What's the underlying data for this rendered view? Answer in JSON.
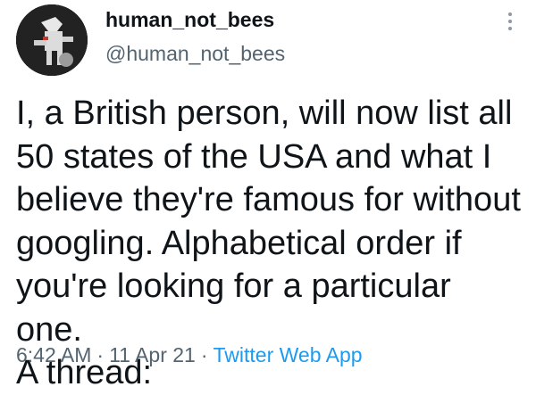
{
  "user": {
    "display_name": "human_not_bees",
    "handle": "@human_not_bees",
    "avatar_icon": "profile-avatar"
  },
  "header": {
    "more_icon": "more-vertical-icon"
  },
  "tweet": {
    "lines": [
      "I, a British person, will now list all",
      "50 states of the USA and what I",
      "believe they're famous for without",
      "googling. Alphabetical order if",
      "you're looking for a particular one.",
      "A thread:"
    ]
  },
  "meta": {
    "time": "6:42 AM",
    "separator": "·",
    "date": "11 Apr 21",
    "source": "Twitter Web App"
  },
  "colors": {
    "text": "#0f1419",
    "secondary": "#536471",
    "link": "#1d9bf0"
  }
}
